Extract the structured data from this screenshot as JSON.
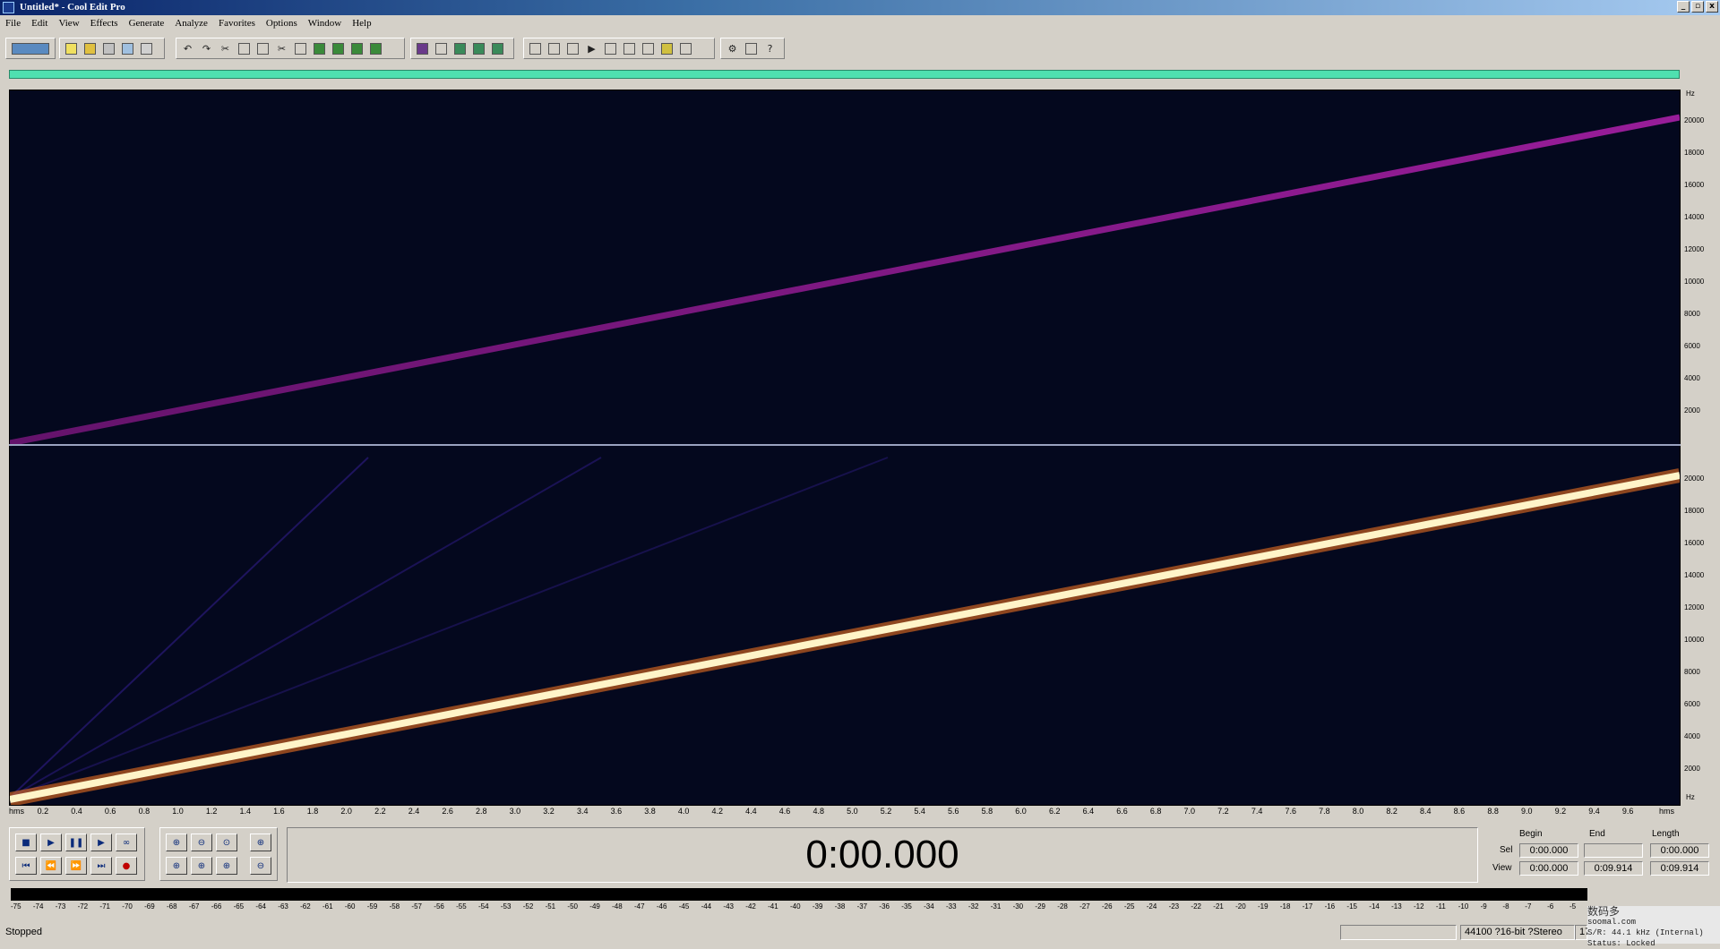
{
  "window": {
    "title": "Untitled* - Cool Edit Pro",
    "controls": [
      "_",
      "▫",
      "x"
    ]
  },
  "menu": [
    "File",
    "Edit",
    "View",
    "Effects",
    "Generate",
    "Analyze",
    "Favorites",
    "Options",
    "Window",
    "Help"
  ],
  "freq_axis": {
    "unit": "Hz",
    "ticks": [
      "20000",
      "18000",
      "16000",
      "14000",
      "12000",
      "10000",
      "8000",
      "6000",
      "4000",
      "2000"
    ]
  },
  "time_axis": {
    "unit": "hms",
    "ticks": [
      "0.2",
      "0.4",
      "0.6",
      "0.8",
      "1.0",
      "1.2",
      "1.4",
      "1.6",
      "1.8",
      "2.0",
      "2.2",
      "2.4",
      "2.6",
      "2.8",
      "3.0",
      "3.2",
      "3.4",
      "3.6",
      "3.8",
      "4.0",
      "4.2",
      "4.4",
      "4.6",
      "4.8",
      "5.0",
      "5.2",
      "5.4",
      "5.6",
      "5.8",
      "6.0",
      "6.2",
      "6.4",
      "6.6",
      "6.8",
      "7.0",
      "7.2",
      "7.4",
      "7.6",
      "7.8",
      "8.0",
      "8.2",
      "8.4",
      "8.6",
      "8.8",
      "9.0",
      "9.2",
      "9.4",
      "9.6"
    ]
  },
  "transport": {
    "time": "0:00.000"
  },
  "selection": {
    "head_begin": "Begin",
    "head_end": "End",
    "head_length": "Length",
    "sel_label": "Sel",
    "view_label": "View",
    "sel_begin": "0:00.000",
    "sel_end": "",
    "sel_length": "0:00.000",
    "view_begin": "0:00.000",
    "view_end": "0:09.914",
    "view_length": "0:09.914"
  },
  "meter_scale": [
    "-75",
    "-74",
    "-73",
    "-72",
    "-71",
    "-70",
    "-69",
    "-68",
    "-67",
    "-66",
    "-65",
    "-64",
    "-63",
    "-62",
    "-61",
    "-60",
    "-59",
    "-58",
    "-57",
    "-56",
    "-55",
    "-54",
    "-53",
    "-52",
    "-51",
    "-50",
    "-49",
    "-48",
    "-47",
    "-46",
    "-45",
    "-44",
    "-43",
    "-42",
    "-41",
    "-40",
    "-39",
    "-38",
    "-37",
    "-36",
    "-35",
    "-34",
    "-33",
    "-32",
    "-31",
    "-30",
    "-29",
    "-28",
    "-27",
    "-26",
    "-25",
    "-24",
    "-23",
    "-22",
    "-21",
    "-20",
    "-19",
    "-18",
    "-17",
    "-16",
    "-15",
    "-14",
    "-13",
    "-12",
    "-11",
    "-10",
    "-9",
    "-8",
    "-7",
    "-6",
    "-5"
  ],
  "status": {
    "state": "Stopped",
    "format": "44100 ?16-bit ?Stereo",
    "extra": "17"
  },
  "overlay": {
    "line1": "数码多",
    "line2": "soomal.com",
    "line3": "S/R: 44.1 kHz (Internal)",
    "line4": "Status: Locked"
  },
  "chart_data": {
    "type": "heatmap",
    "title": "",
    "xlabel": "hms",
    "ylabel": "Hz",
    "xlim": [
      0,
      9.914
    ],
    "ylim": [
      0,
      22050
    ],
    "channels": [
      {
        "name": "",
        "sweep_start_hz": 0,
        "sweep_end_hz": 20000,
        "color": "#8a1a8a"
      },
      {
        "name": "",
        "sweep_start_hz": 0,
        "sweep_end_hz": 20000,
        "color": "#fff0c0"
      }
    ]
  }
}
